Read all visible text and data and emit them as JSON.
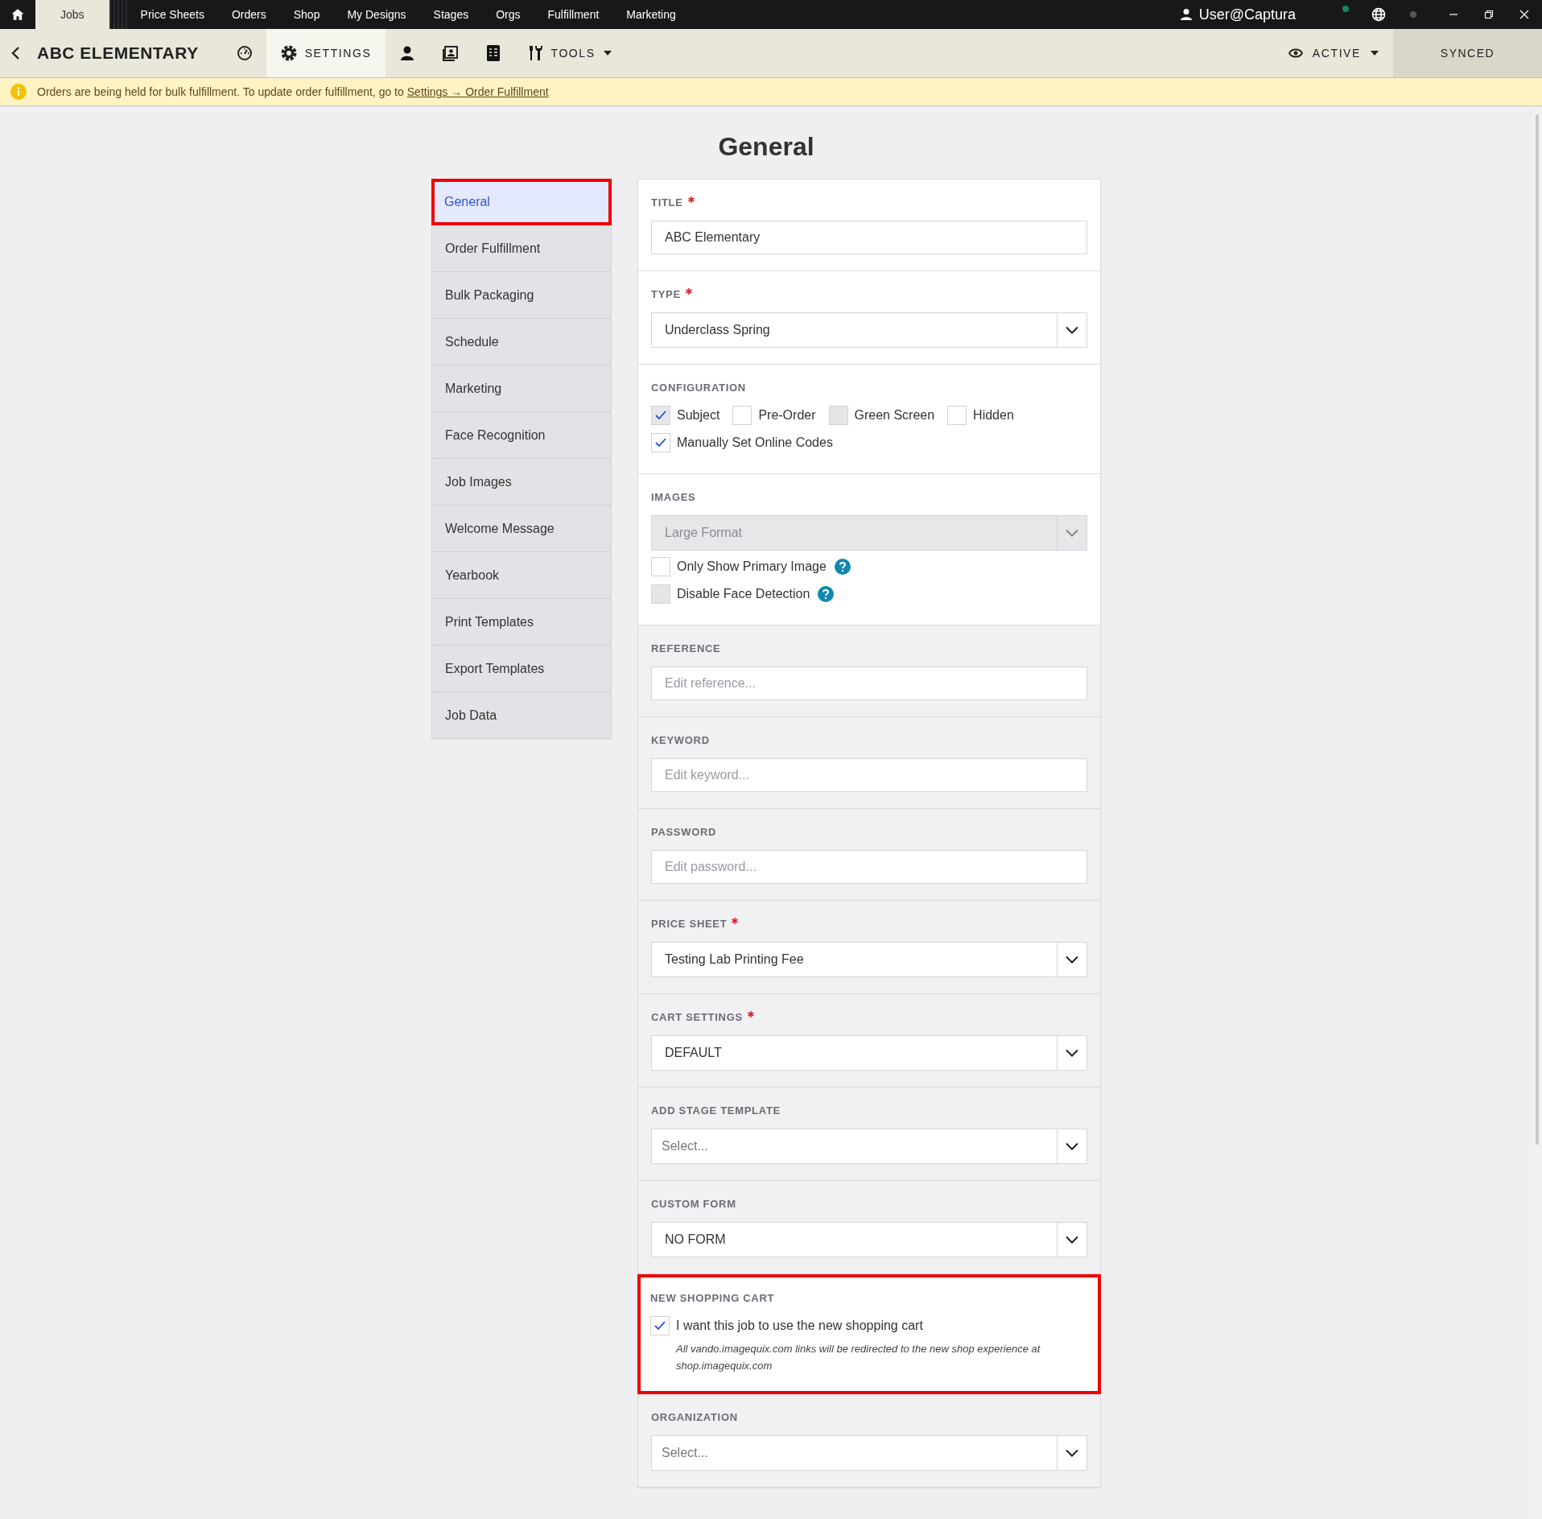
{
  "top_nav": {
    "tabs": [
      {
        "label": "Jobs",
        "selected": true
      },
      {
        "label": "Price Sheets",
        "selected": false
      },
      {
        "label": "Orders",
        "selected": false
      },
      {
        "label": "Shop",
        "selected": false
      },
      {
        "label": "My Designs",
        "selected": false
      },
      {
        "label": "Stages",
        "selected": false
      },
      {
        "label": "Orgs",
        "selected": false
      },
      {
        "label": "Fulfillment",
        "selected": false
      },
      {
        "label": "Marketing",
        "selected": false
      }
    ],
    "user": "User@Captura"
  },
  "job_header": {
    "title": "ABC ELEMENTARY",
    "tabs": [
      {
        "kind": "dashboard",
        "selected": false
      },
      {
        "kind": "settings",
        "label": "SETTINGS",
        "selected": true
      },
      {
        "kind": "subjects",
        "selected": false
      },
      {
        "kind": "photos",
        "selected": false
      },
      {
        "kind": "orders",
        "selected": false
      },
      {
        "kind": "tools",
        "label": "TOOLS",
        "selected": false
      }
    ],
    "status": "ACTIVE",
    "sync": "SYNCED"
  },
  "banner": {
    "text": "Orders are being held for bulk fulfillment. To update order fulfillment, go to",
    "link": "Settings → Order Fulfillment"
  },
  "page_title": "General",
  "sidebar": {
    "items": [
      {
        "label": "General",
        "selected": true,
        "highlighted": true
      },
      {
        "label": "Order Fulfillment",
        "selected": false,
        "highlighted": false
      },
      {
        "label": "Bulk Packaging",
        "selected": false,
        "highlighted": false
      },
      {
        "label": "Schedule",
        "selected": false,
        "highlighted": false
      },
      {
        "label": "Marketing",
        "selected": false,
        "highlighted": false
      },
      {
        "label": "Face Recognition",
        "selected": false,
        "highlighted": false
      },
      {
        "label": "Job Images",
        "selected": false,
        "highlighted": false
      },
      {
        "label": "Welcome Message",
        "selected": false,
        "highlighted": false
      },
      {
        "label": "Yearbook",
        "selected": false,
        "highlighted": false
      },
      {
        "label": "Print Templates",
        "selected": false,
        "highlighted": false
      },
      {
        "label": "Export Templates",
        "selected": false,
        "highlighted": false
      },
      {
        "label": "Job Data",
        "selected": false,
        "highlighted": false
      }
    ]
  },
  "form": {
    "sections": [
      {
        "label": "TITLE",
        "required": true,
        "shaded": false,
        "highlighted": false,
        "field": {
          "kind": "text",
          "value": "ABC Elementary"
        }
      },
      {
        "label": "TYPE",
        "required": true,
        "shaded": false,
        "highlighted": false,
        "field": {
          "kind": "select",
          "value": "Underclass Spring"
        }
      },
      {
        "label": "CONFIGURATION",
        "required": false,
        "shaded": false,
        "highlighted": false,
        "option_rows": [
          {
            "options": [
              {
                "label": "Subject",
                "checked": true,
                "disabled": true
              },
              {
                "label": "Pre-Order",
                "checked": false,
                "disabled": false
              },
              {
                "label": "Green Screen",
                "checked": false,
                "disabled": true
              },
              {
                "label": "Hidden",
                "checked": false,
                "disabled": false
              }
            ]
          },
          {
            "options": [
              {
                "label": "Manually Set Online Codes",
                "checked": true,
                "disabled": false
              }
            ]
          }
        ]
      },
      {
        "label": "IMAGES",
        "required": false,
        "shaded": false,
        "highlighted": false,
        "field": {
          "kind": "select",
          "value": "Large Format",
          "disabled": true
        },
        "option_rows": [
          {
            "options": [
              {
                "label": "Only Show Primary Image",
                "checked": false,
                "disabled": false,
                "help": true
              }
            ]
          },
          {
            "options": [
              {
                "label": "Disable Face Detection",
                "checked": false,
                "disabled": true,
                "help": true
              }
            ]
          }
        ]
      },
      {
        "label": "REFERENCE",
        "required": false,
        "shaded": true,
        "highlighted": false,
        "field": {
          "kind": "text",
          "placeholder": "Edit reference..."
        }
      },
      {
        "label": "KEYWORD",
        "required": false,
        "shaded": true,
        "highlighted": false,
        "field": {
          "kind": "text",
          "placeholder": "Edit keyword..."
        }
      },
      {
        "label": "PASSWORD",
        "required": false,
        "shaded": true,
        "highlighted": false,
        "field": {
          "kind": "text",
          "placeholder": "Edit password..."
        }
      },
      {
        "label": "PRICE SHEET",
        "required": true,
        "shaded": true,
        "highlighted": false,
        "field": {
          "kind": "select",
          "value": "Testing Lab Printing Fee"
        }
      },
      {
        "label": "CART SETTINGS",
        "required": true,
        "shaded": true,
        "highlighted": false,
        "field": {
          "kind": "select",
          "value": "DEFAULT"
        }
      },
      {
        "label": "ADD STAGE TEMPLATE",
        "required": false,
        "shaded": true,
        "highlighted": false,
        "field": {
          "kind": "select",
          "placeholder": "Select..."
        }
      },
      {
        "label": "CUSTOM FORM",
        "required": false,
        "shaded": true,
        "highlighted": false,
        "field": {
          "kind": "select",
          "value": "NO FORM"
        }
      },
      {
        "label": "NEW SHOPPING CART",
        "required": false,
        "shaded": false,
        "highlighted": true,
        "option_rows": [
          {
            "options": [
              {
                "label": "I want this job to use the new shopping cart",
                "checked": true,
                "disabled": false
              }
            ]
          }
        ],
        "note": "All vando.imagequix.com links will be redirected to the new shop experience at shop.imagequix.com"
      },
      {
        "label": "ORGANIZATION",
        "required": false,
        "shaded": true,
        "highlighted": false,
        "field": {
          "kind": "select",
          "placeholder": "Select..."
        }
      }
    ]
  }
}
